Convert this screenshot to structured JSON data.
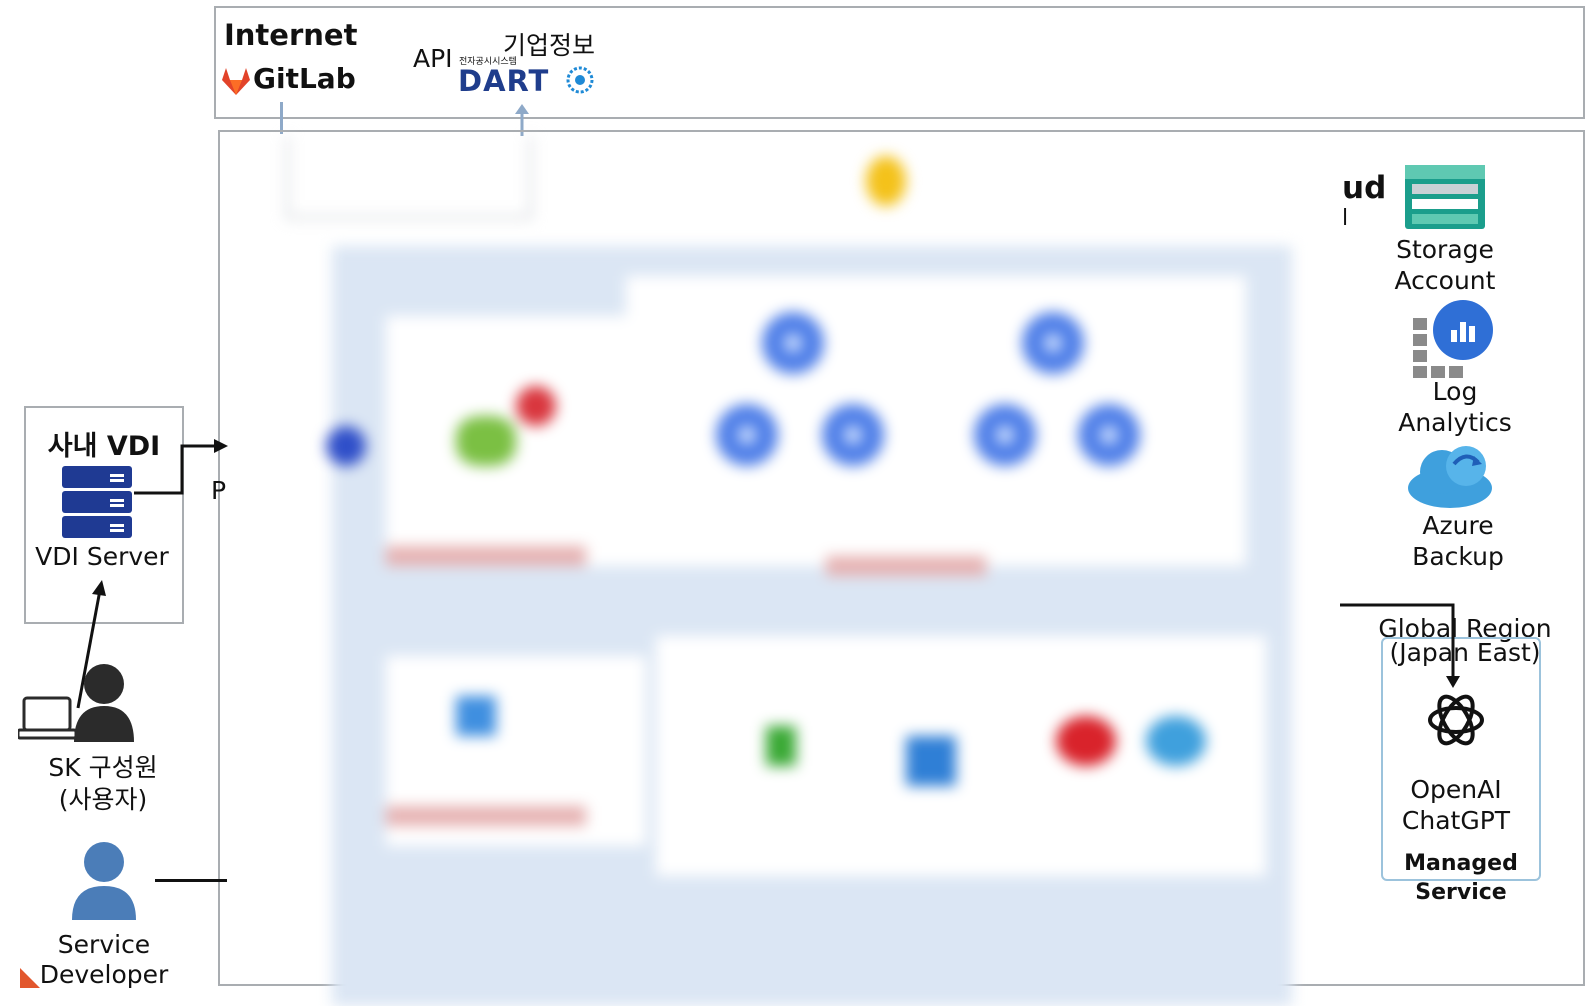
{
  "internet": {
    "title": "Internet",
    "gitlab_label": "GitLab",
    "api_label": "API",
    "corp_info_label": "기업정보",
    "dart_sub_label": "전자공시시스템",
    "dart_label": "DART"
  },
  "cloud_partial": {
    "title_fragment": "ud",
    "subtitle_fragment": "l",
    "p_fragment": "P"
  },
  "vdi": {
    "title": "사내 VDI",
    "server_label": "VDI Server"
  },
  "users": {
    "member_label": "SK 구성원",
    "member_sub": "(사용자)",
    "developer_label": "Service",
    "developer_label2": "Developer"
  },
  "services": {
    "storage_line1": "Storage",
    "storage_line2": "Account",
    "log_line1": "Log",
    "log_line2": "Analytics",
    "backup_line1": "Azure",
    "backup_line2": "Backup"
  },
  "global": {
    "region_line1": "Global Region",
    "region_line2": "(Japan East)",
    "openai_line1": "OpenAI",
    "openai_line2": "ChatGPT",
    "managed_line1": "Managed",
    "managed_line2": "Service"
  },
  "colors": {
    "box_border": "#a9adb1",
    "arrow_blue": "#8ea9c8",
    "server_navy": "#1f3a93",
    "person_dark": "#2b2b2b",
    "person_blue": "#4b7db8",
    "storage_teal": "#1b9e8c",
    "log_blue": "#2f6fd6",
    "cloud_blue": "#3fa0dd",
    "managed_border": "#9cc3dc",
    "gitlab_orange": "#e24329"
  }
}
